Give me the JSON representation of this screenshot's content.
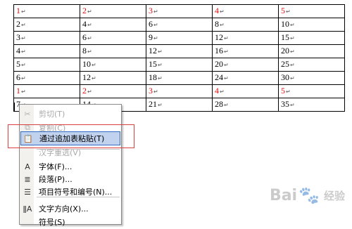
{
  "table": {
    "rows": [
      {
        "cells": [
          "1",
          "2",
          "3",
          "4",
          "5"
        ],
        "red": true
      },
      {
        "cells": [
          "2",
          "4",
          "6",
          "8",
          "10"
        ],
        "red": false
      },
      {
        "cells": [
          "3",
          "6",
          "9",
          "12",
          "15"
        ],
        "red": false
      },
      {
        "cells": [
          "4",
          "8",
          "12",
          "16",
          "20"
        ],
        "red": false
      },
      {
        "cells": [
          "5",
          "10",
          "15",
          "20",
          "25"
        ],
        "red": false
      },
      {
        "cells": [
          "6",
          "12",
          "18",
          "24",
          "30"
        ],
        "red": false
      },
      {
        "cells": [
          "1",
          "2",
          "3",
          "4",
          "5"
        ],
        "red": true
      },
      {
        "cells": [
          "7",
          "14",
          "21",
          "28",
          "35"
        ],
        "red": false
      }
    ],
    "cell_mark": "↵",
    "red_color": "#e01010"
  },
  "context_menu": {
    "items": [
      {
        "label": "剪切(T)",
        "icon": "scissors-icon",
        "glyph": "✂",
        "disabled": true,
        "highlighted": false,
        "name": "menu-item-cut"
      },
      {
        "label": "复制(C)",
        "icon": "copy-icon",
        "glyph": "⧉",
        "disabled": true,
        "highlighted": false,
        "name": "menu-item-copy"
      },
      {
        "label": "通过追加表粘贴(T)",
        "icon": "paste-icon",
        "glyph": "📋",
        "disabled": false,
        "highlighted": true,
        "name": "menu-item-append-table-paste"
      },
      {
        "label": "汉字重选(V)",
        "icon": "",
        "glyph": "",
        "disabled": true,
        "highlighted": false,
        "name": "menu-item-hanzi-reselect"
      },
      {
        "label": "字体(F)...",
        "icon": "font-icon",
        "glyph": "A",
        "disabled": false,
        "highlighted": false,
        "name": "menu-item-font"
      },
      {
        "label": "段落(P)...",
        "icon": "paragraph-icon",
        "glyph": "≣",
        "disabled": false,
        "highlighted": false,
        "name": "menu-item-paragraph"
      },
      {
        "label": "项目符号和编号(N)...",
        "icon": "bullets-icon",
        "glyph": "☰",
        "disabled": false,
        "highlighted": false,
        "name": "menu-item-bullets-numbering"
      },
      {
        "label": "文字方向(X)...",
        "icon": "text-direction-icon",
        "glyph": "ǁA",
        "disabled": false,
        "highlighted": false,
        "name": "menu-item-text-direction"
      },
      {
        "label": "符号(S)",
        "icon": "",
        "glyph": "",
        "disabled": false,
        "highlighted": false,
        "name": "menu-item-symbol"
      }
    ],
    "highlight_color": "#c1d2ee",
    "highlight_border": "#316ac5"
  },
  "annotation": {
    "box_color": "#d94040"
  },
  "watermark": {
    "text": "Bai",
    "suffix": "经验"
  }
}
